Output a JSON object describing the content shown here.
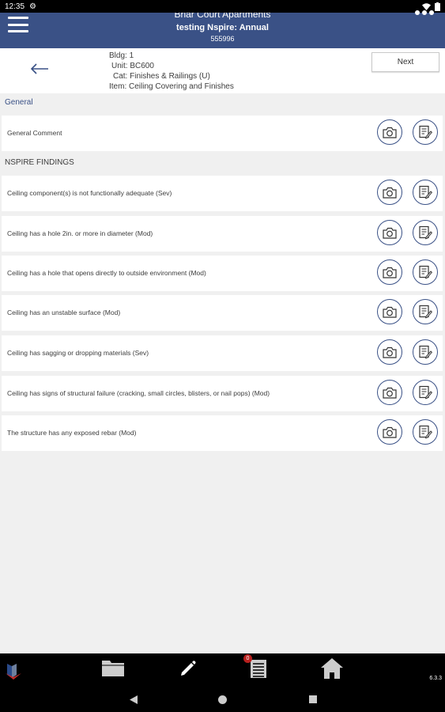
{
  "status_bar": {
    "time": "12:35"
  },
  "header": {
    "property": "Briar Court Apartments",
    "inspection": "testing Nspire: Annual",
    "code": "555996"
  },
  "info": {
    "bldg": "Bldg: 1",
    "unit": "Unit: BC600",
    "cat": "Cat: Finishes & Railings (U)",
    "item": "Item: Ceiling Covering and Finishes"
  },
  "next_label": "Next",
  "general": {
    "title": "General",
    "comment_label": "General Comment"
  },
  "findings": {
    "title": "NSPIRE FINDINGS",
    "items": [
      "Ceiling component(s) is not functionally adequate (Sev)",
      "Ceiling has a hole 2in. or more in diameter (Mod)",
      "Ceiling has a hole that opens directly to outside environment (Mod)",
      "Ceiling has an unstable surface (Mod)",
      "Ceiling has sagging or dropping materials (Sev)",
      "Ceiling has signs of structural failure (cracking, small circles, blisters, or nail pops) (Mod)",
      "The structure has any exposed rebar (Mod)"
    ]
  },
  "bottom_nav": {
    "badge_count": "0",
    "version": "6.3.3",
    "icons": [
      "logo-icon",
      "folder-icon",
      "pencil-icon",
      "checklist-icon",
      "home-icon"
    ]
  },
  "colors": {
    "header": "#3a5186",
    "accent": "#3a5186",
    "badge": "#b8201e"
  }
}
